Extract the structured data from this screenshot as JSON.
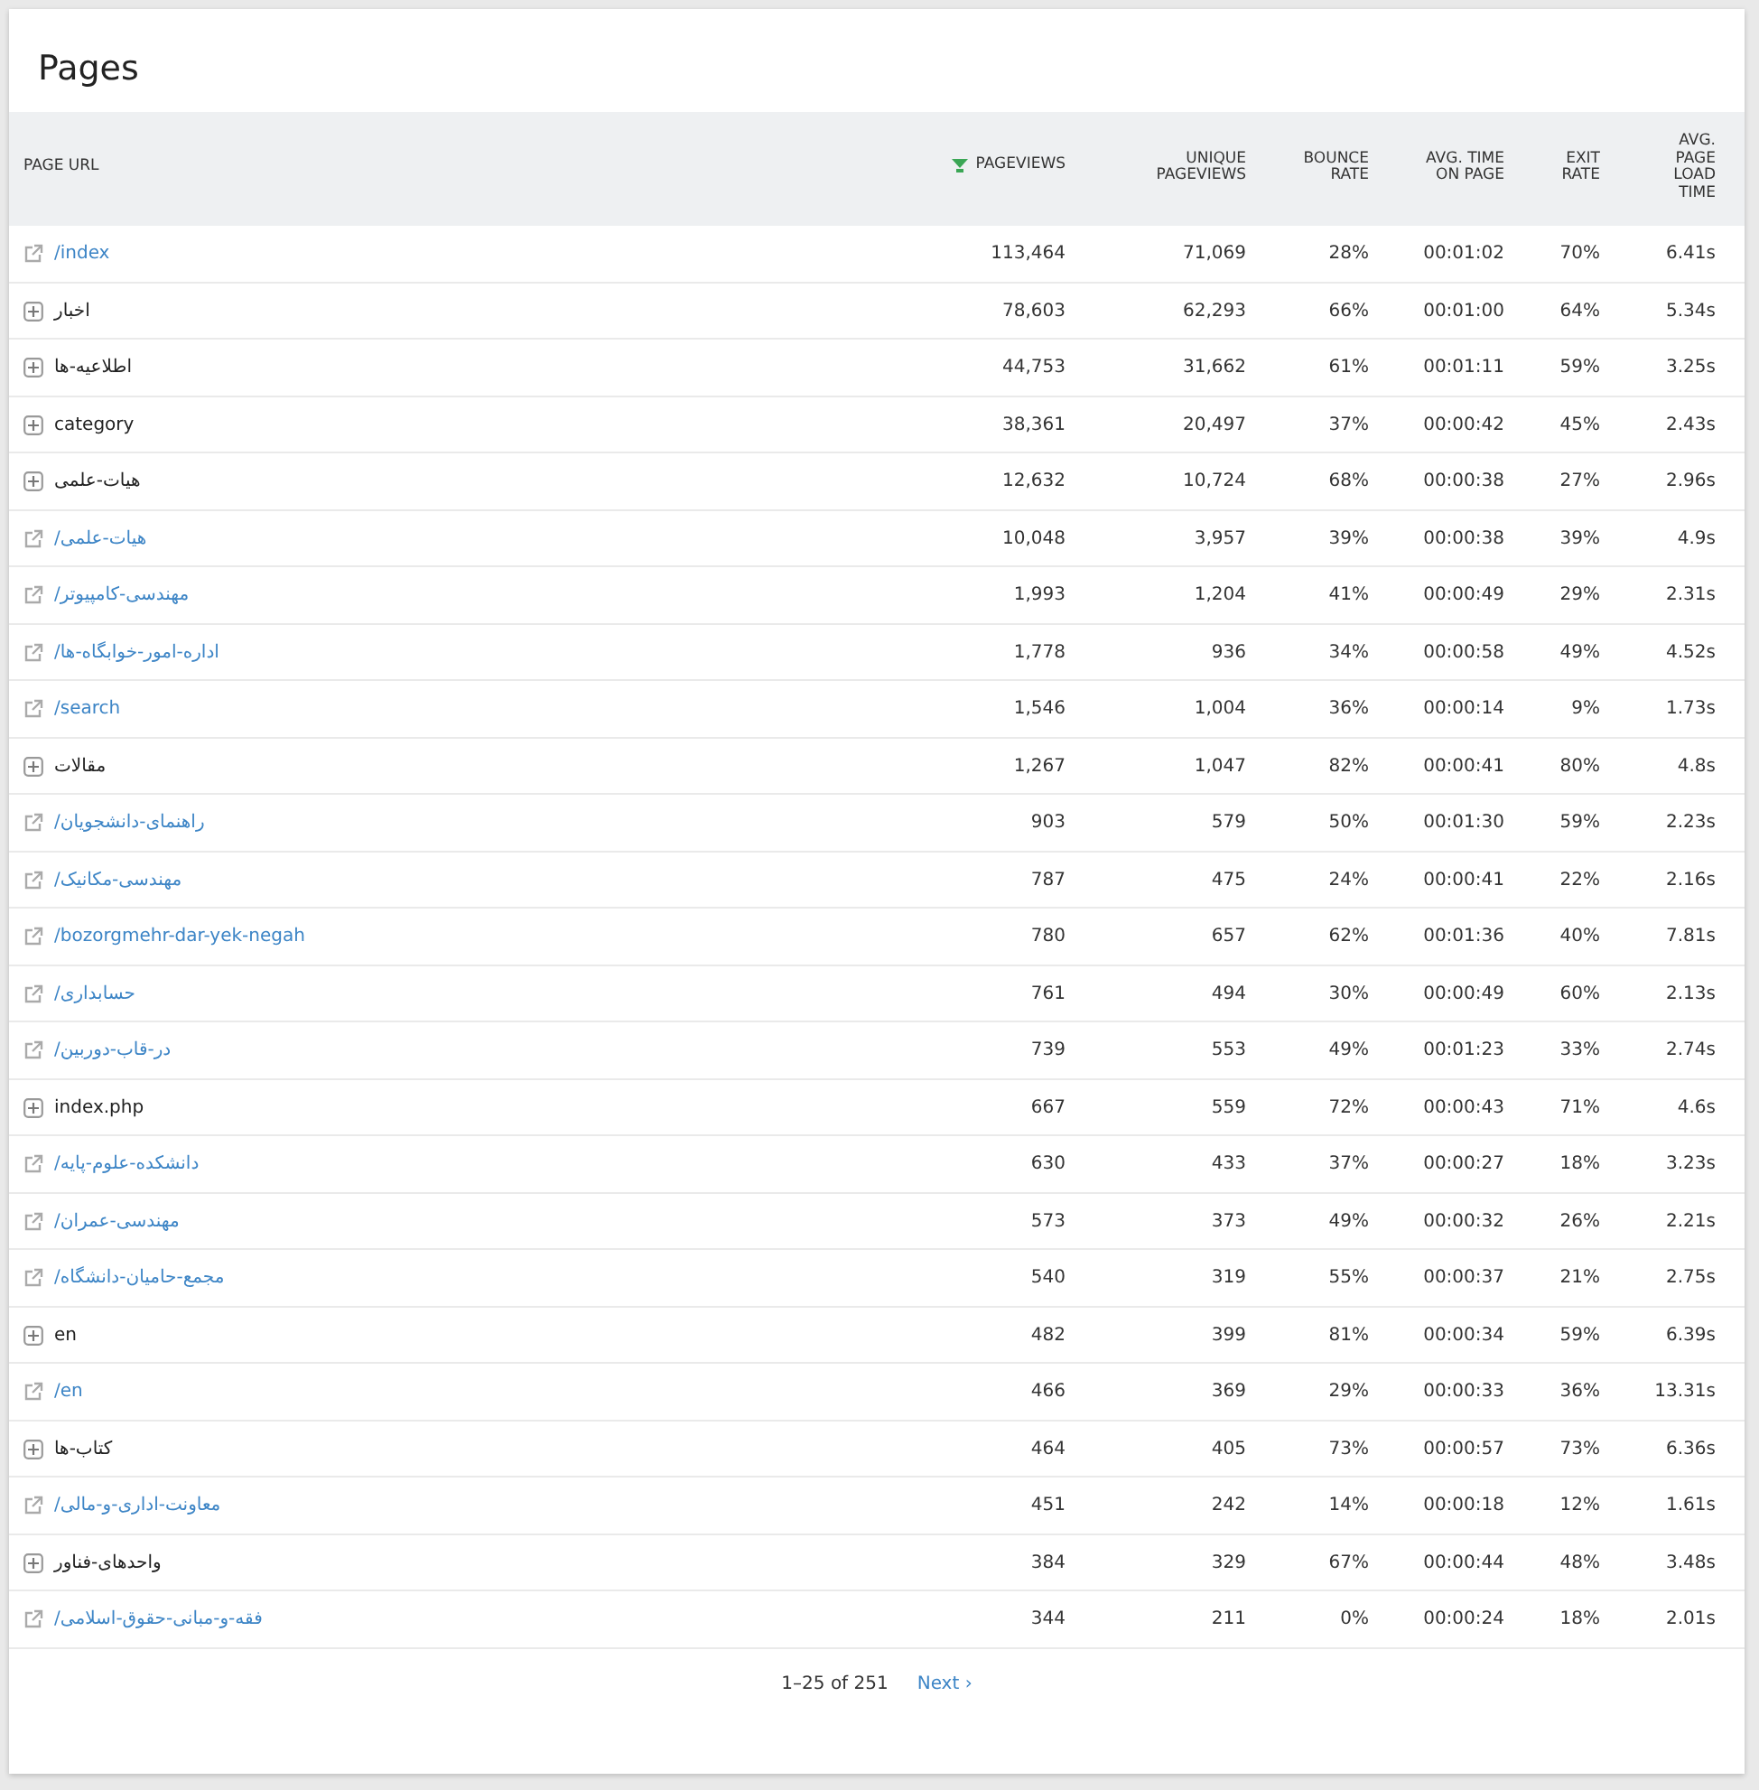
{
  "title": "Pages",
  "table": {
    "columns": [
      {
        "label": "PAGE URL",
        "sorted": false
      },
      {
        "label": "PAGEVIEWS",
        "sorted": true
      },
      {
        "label": "UNIQUE PAGEVIEWS",
        "sorted": false
      },
      {
        "label": "BOUNCE RATE",
        "sorted": false
      },
      {
        "label": "AVG. TIME ON PAGE",
        "sorted": false
      },
      {
        "label": "EXIT RATE",
        "sorted": false
      },
      {
        "label": "AVG. PAGE LOAD TIME",
        "sorted": false
      }
    ],
    "rows": [
      {
        "kind": "link",
        "cells": [
          "/index",
          "113,464",
          "71,069",
          "28%",
          "00:01:02",
          "70%",
          "6.41s"
        ]
      },
      {
        "kind": "folder",
        "cells": [
          "اخبار",
          "78,603",
          "62,293",
          "66%",
          "00:01:00",
          "64%",
          "5.34s"
        ]
      },
      {
        "kind": "folder",
        "cells": [
          "اطلاعیه-ها",
          "44,753",
          "31,662",
          "61%",
          "00:01:11",
          "59%",
          "3.25s"
        ]
      },
      {
        "kind": "folder",
        "cells": [
          "category",
          "38,361",
          "20,497",
          "37%",
          "00:00:42",
          "45%",
          "2.43s"
        ]
      },
      {
        "kind": "folder",
        "cells": [
          "هیات-علمی",
          "12,632",
          "10,724",
          "68%",
          "00:00:38",
          "27%",
          "2.96s"
        ]
      },
      {
        "kind": "link",
        "cells": [
          "/هیات-علمی",
          "10,048",
          "3,957",
          "39%",
          "00:00:38",
          "39%",
          "4.9s"
        ]
      },
      {
        "kind": "link",
        "cells": [
          "/مهندسی-کامپیوتر",
          "1,993",
          "1,204",
          "41%",
          "00:00:49",
          "29%",
          "2.31s"
        ]
      },
      {
        "kind": "link",
        "cells": [
          "/اداره-امور-خوابگاه-ها",
          "1,778",
          "936",
          "34%",
          "00:00:58",
          "49%",
          "4.52s"
        ]
      },
      {
        "kind": "link",
        "cells": [
          "/search",
          "1,546",
          "1,004",
          "36%",
          "00:00:14",
          "9%",
          "1.73s"
        ]
      },
      {
        "kind": "folder",
        "cells": [
          "مقالات",
          "1,267",
          "1,047",
          "82%",
          "00:00:41",
          "80%",
          "4.8s"
        ]
      },
      {
        "kind": "link",
        "cells": [
          "/راهنمای-دانشجویان",
          "903",
          "579",
          "50%",
          "00:01:30",
          "59%",
          "2.23s"
        ]
      },
      {
        "kind": "link",
        "cells": [
          "/مهندسی-مکانیک",
          "787",
          "475",
          "24%",
          "00:00:41",
          "22%",
          "2.16s"
        ]
      },
      {
        "kind": "link",
        "cells": [
          "/bozorgmehr-dar-yek-negah",
          "780",
          "657",
          "62%",
          "00:01:36",
          "40%",
          "7.81s"
        ]
      },
      {
        "kind": "link",
        "cells": [
          "/حسابداری",
          "761",
          "494",
          "30%",
          "00:00:49",
          "60%",
          "2.13s"
        ]
      },
      {
        "kind": "link",
        "cells": [
          "/در-قاب-دوربین",
          "739",
          "553",
          "49%",
          "00:01:23",
          "33%",
          "2.74s"
        ]
      },
      {
        "kind": "folder",
        "cells": [
          "index.php",
          "667",
          "559",
          "72%",
          "00:00:43",
          "71%",
          "4.6s"
        ]
      },
      {
        "kind": "link",
        "cells": [
          "/دانشکده-علوم-پایه",
          "630",
          "433",
          "37%",
          "00:00:27",
          "18%",
          "3.23s"
        ]
      },
      {
        "kind": "link",
        "cells": [
          "/مهندسی-عمران",
          "573",
          "373",
          "49%",
          "00:00:32",
          "26%",
          "2.21s"
        ]
      },
      {
        "kind": "link",
        "cells": [
          "/مجمع-حامیان-دانشگاه",
          "540",
          "319",
          "55%",
          "00:00:37",
          "21%",
          "2.75s"
        ]
      },
      {
        "kind": "folder",
        "cells": [
          "en",
          "482",
          "399",
          "81%",
          "00:00:34",
          "59%",
          "6.39s"
        ]
      },
      {
        "kind": "link",
        "cells": [
          "/en",
          "466",
          "369",
          "29%",
          "00:00:33",
          "36%",
          "13.31s"
        ]
      },
      {
        "kind": "folder",
        "cells": [
          "کتاب-ها",
          "464",
          "405",
          "73%",
          "00:00:57",
          "73%",
          "6.36s"
        ]
      },
      {
        "kind": "link",
        "cells": [
          "/معاونت-اداری-و-مالی",
          "451",
          "242",
          "14%",
          "00:00:18",
          "12%",
          "1.61s"
        ]
      },
      {
        "kind": "folder",
        "cells": [
          "واحدهای-فناور",
          "384",
          "329",
          "67%",
          "00:00:44",
          "48%",
          "3.48s"
        ]
      },
      {
        "kind": "link",
        "cells": [
          "/فقه-و-مبانی-حقوق-اسلامی",
          "344",
          "211",
          "0%",
          "00:00:24",
          "18%",
          "2.01s"
        ]
      }
    ]
  },
  "pagination": {
    "range": "1–25 of 251",
    "next": "Next ›"
  }
}
